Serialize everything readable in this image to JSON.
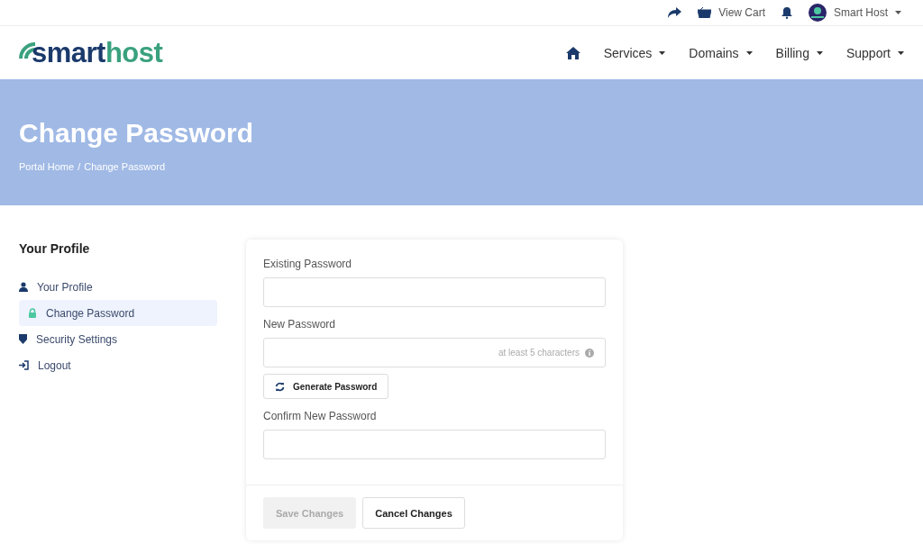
{
  "top_bar": {
    "cart": "View Cart",
    "account": "Smart Host"
  },
  "logo": {
    "first": "smart",
    "second": "host"
  },
  "nav": [
    {
      "label": "Services"
    },
    {
      "label": "Domains"
    },
    {
      "label": "Billing"
    },
    {
      "label": "Support"
    }
  ],
  "banner": {
    "title": "Change Password",
    "breadcrumb_separator": "/",
    "breadcrumb": [
      {
        "label": "Portal Home"
      },
      {
        "label": "Change Password"
      }
    ]
  },
  "sidebar": {
    "title": "Your Profile",
    "items": [
      {
        "label": "Your Profile",
        "selected": false
      },
      {
        "label": "Change Password",
        "selected": true
      },
      {
        "label": "Security Settings",
        "selected": false
      },
      {
        "label": "Logout",
        "selected": false
      }
    ]
  },
  "form": {
    "fields": [
      {
        "label": "Existing Password"
      },
      {
        "label": "New Password",
        "hint": "at least 5 characters"
      },
      {
        "label": "Confirm New Password"
      }
    ],
    "generate_button": "Generate Password",
    "buttons": [
      {
        "label": "Save Changes",
        "disabled": true
      },
      {
        "label": "Cancel Changes",
        "disabled": false
      }
    ]
  }
}
